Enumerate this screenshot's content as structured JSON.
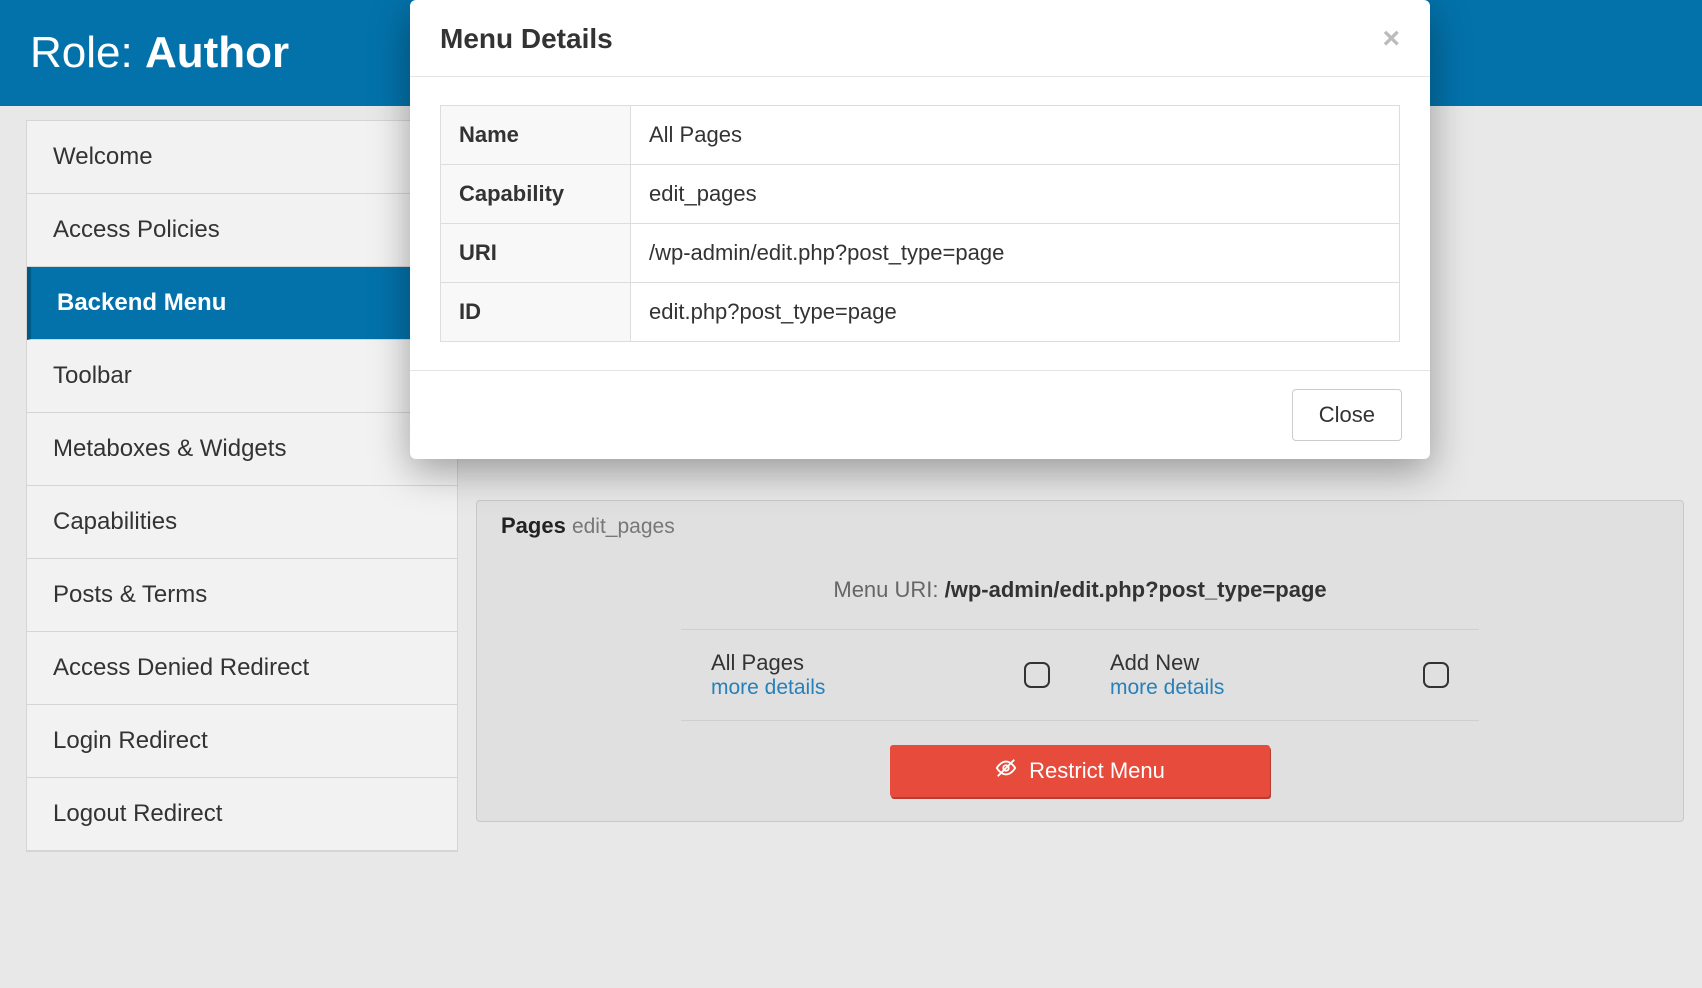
{
  "header": {
    "prefix": "Role: ",
    "role_name": "Author"
  },
  "sidebar": {
    "items": [
      {
        "label": "Welcome",
        "active": false
      },
      {
        "label": "Access Policies",
        "active": false
      },
      {
        "label": "Backend Menu",
        "active": true
      },
      {
        "label": "Toolbar",
        "active": false
      },
      {
        "label": "Metaboxes & Widgets",
        "active": false
      },
      {
        "label": "Capabilities",
        "active": false
      },
      {
        "label": "Posts & Terms",
        "active": false
      },
      {
        "label": "Access Denied Redirect",
        "active": false
      },
      {
        "label": "Login Redirect",
        "active": false
      },
      {
        "label": "Logout Redirect",
        "active": false
      }
    ]
  },
  "panel": {
    "title": "Pages",
    "capability": "edit_pages",
    "uri_label": "Menu URI: ",
    "uri_value": "/wp-admin/edit.php?post_type=page",
    "submenus": [
      {
        "name": "All Pages",
        "more": "more details"
      },
      {
        "name": "Add New",
        "more": "more details"
      }
    ],
    "restrict_label": "Restrict Menu"
  },
  "modal": {
    "title": "Menu Details",
    "close_x": "×",
    "close_button": "Close",
    "rows": [
      {
        "key": "Name",
        "value": "All Pages"
      },
      {
        "key": "Capability",
        "value": "edit_pages"
      },
      {
        "key": "URI",
        "value": "/wp-admin/edit.php?post_type=page"
      },
      {
        "key": "ID",
        "value": "edit.php?post_type=page"
      }
    ]
  }
}
